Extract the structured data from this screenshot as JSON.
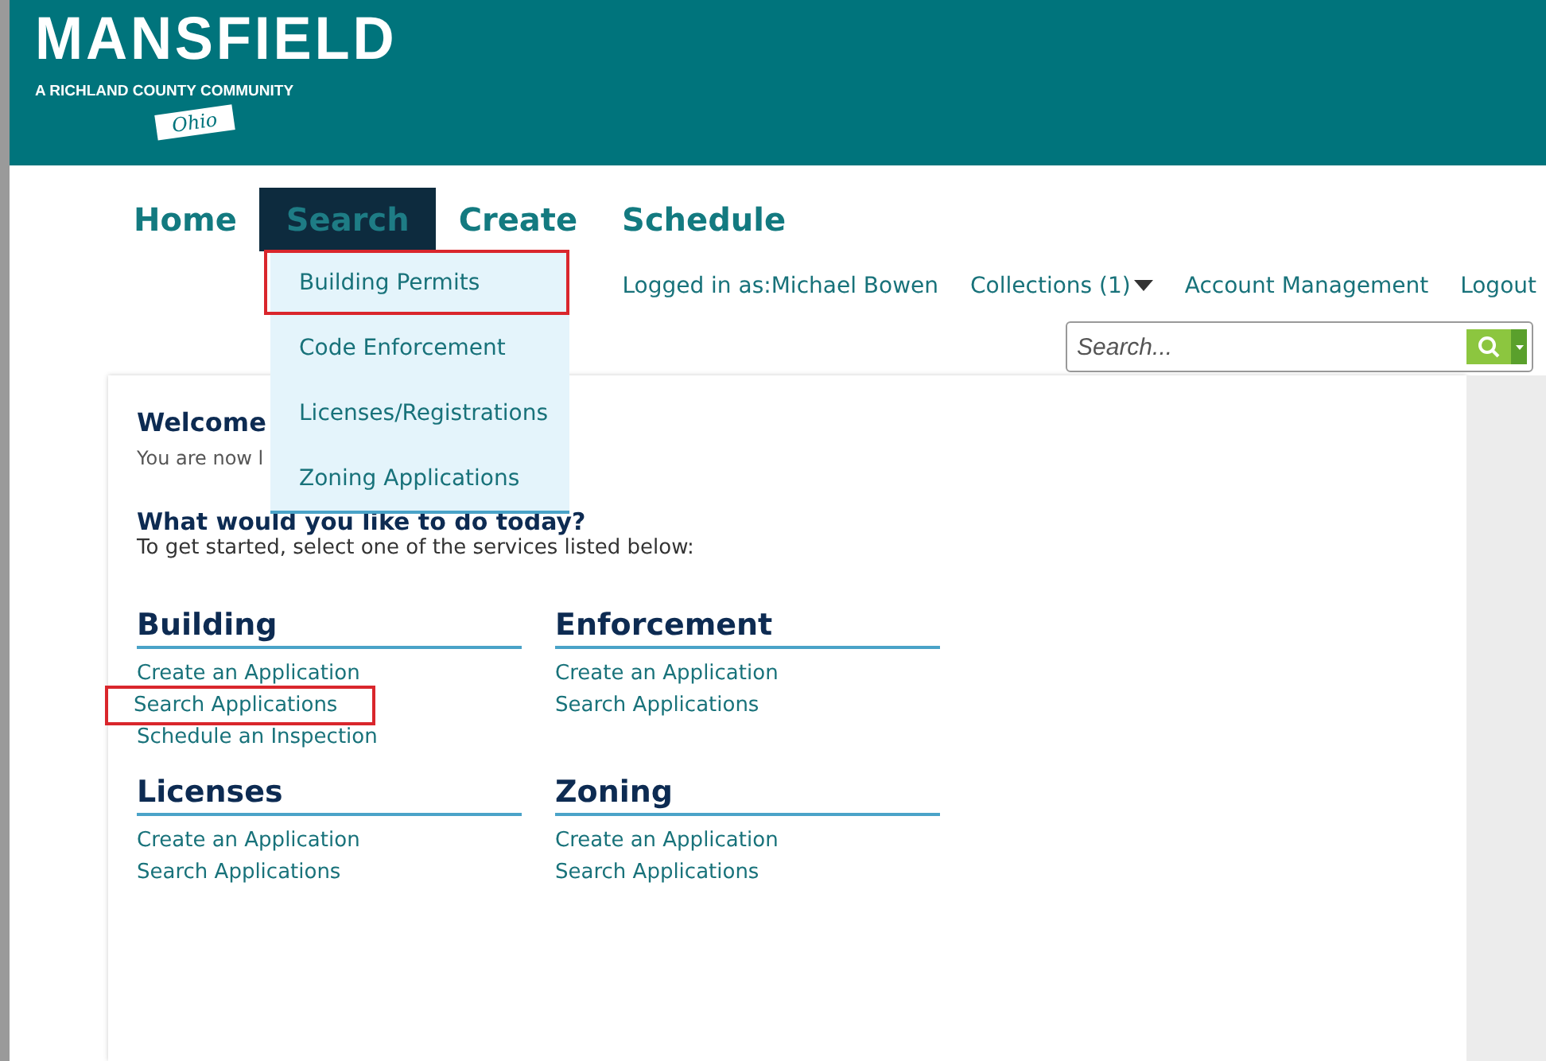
{
  "header": {
    "logo_title": "MANSFIELD",
    "logo_subtitle": "A RICHLAND COUNTY COMMUNITY",
    "logo_ribbon": "Ohio"
  },
  "nav": [
    {
      "label": "Home",
      "selected": false
    },
    {
      "label": "Search",
      "selected": true
    },
    {
      "label": "Create",
      "selected": false
    },
    {
      "label": "Schedule",
      "selected": false
    }
  ],
  "dropdown": [
    {
      "label": "Building Permits",
      "highlighted": true
    },
    {
      "label": "Code Enforcement",
      "highlighted": false
    },
    {
      "label": "Licenses/Registrations",
      "highlighted": false
    },
    {
      "label": "Zoning Applications",
      "highlighted": false
    }
  ],
  "user_bar": {
    "logged_in": "Logged in as:Michael Bowen",
    "collections": "Collections (1)",
    "account": "Account Management",
    "logout": "Logout"
  },
  "search": {
    "placeholder": "Search..."
  },
  "welcome": {
    "title": "Welcome",
    "text": "You are now l",
    "question": "What would you like to do today?",
    "instruction": "To get started, select one of the services listed below:"
  },
  "services": [
    {
      "title": "Building",
      "links": [
        {
          "label": "Create an Application",
          "highlighted": false
        },
        {
          "label": "Search Applications",
          "highlighted": true
        },
        {
          "label": "Schedule an Inspection",
          "highlighted": false
        }
      ]
    },
    {
      "title": "Enforcement",
      "links": [
        {
          "label": "Create an Application",
          "highlighted": false
        },
        {
          "label": "Search Applications",
          "highlighted": false
        }
      ]
    },
    {
      "title": "Licenses",
      "links": [
        {
          "label": "Create an Application",
          "highlighted": false
        },
        {
          "label": "Search Applications",
          "highlighted": false
        }
      ]
    },
    {
      "title": "Zoning",
      "links": [
        {
          "label": "Create an Application",
          "highlighted": false
        },
        {
          "label": "Search Applications",
          "highlighted": false
        }
      ]
    }
  ]
}
